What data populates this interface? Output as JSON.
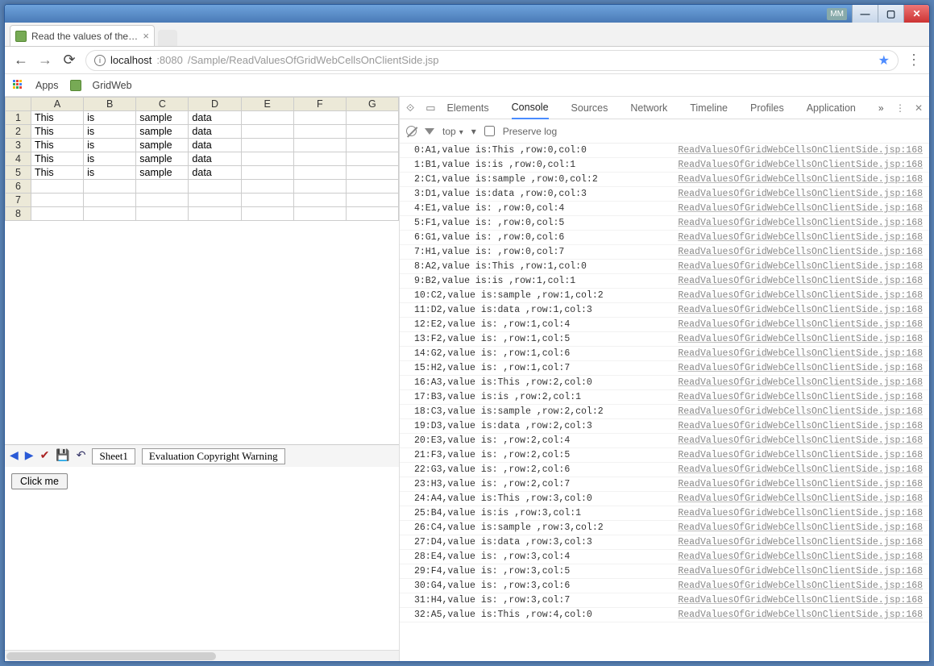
{
  "window": {
    "mm": "MM"
  },
  "tab": {
    "title": "Read the values of the G"
  },
  "url": {
    "host_prefix": "localhost",
    "host_port": ":8080",
    "path": "/Sample/ReadValuesOfGridWebCellsOnClientSide.jsp"
  },
  "bookmarks": {
    "apps": "Apps",
    "gridweb": "GridWeb"
  },
  "grid": {
    "columns": [
      "A",
      "B",
      "C",
      "D",
      "E",
      "F",
      "G"
    ],
    "rowcount": 8,
    "data": [
      [
        "This",
        "is",
        "sample",
        "data",
        "",
        "",
        ""
      ],
      [
        "This",
        "is",
        "sample",
        "data",
        "",
        "",
        ""
      ],
      [
        "This",
        "is",
        "sample",
        "data",
        "",
        "",
        ""
      ],
      [
        "This",
        "is",
        "sample",
        "data",
        "",
        "",
        ""
      ],
      [
        "This",
        "is",
        "sample",
        "data",
        "",
        "",
        ""
      ],
      [
        "",
        "",
        "",
        "",
        "",
        "",
        ""
      ],
      [
        "",
        "",
        "",
        "",
        "",
        "",
        ""
      ],
      [
        "",
        "",
        "",
        "",
        "",
        "",
        ""
      ]
    ]
  },
  "sheet_toolbar": {
    "sheet": "Sheet1",
    "warning": "Evaluation Copyright Warning"
  },
  "button": {
    "label": "Click me"
  },
  "devtools": {
    "tabs": [
      "Elements",
      "Console",
      "Sources",
      "Network",
      "Timeline",
      "Profiles",
      "Application"
    ],
    "active_tab": "Console",
    "filter_top": "top",
    "preserve_log": "Preserve log",
    "source_link": "ReadValuesOfGridWebCellsOnClientSide.jsp:168",
    "log_vals": [
      "This",
      "is",
      "sample",
      "data"
    ],
    "cols": [
      "A",
      "B",
      "C",
      "D",
      "E",
      "F",
      "G",
      "H"
    ]
  }
}
